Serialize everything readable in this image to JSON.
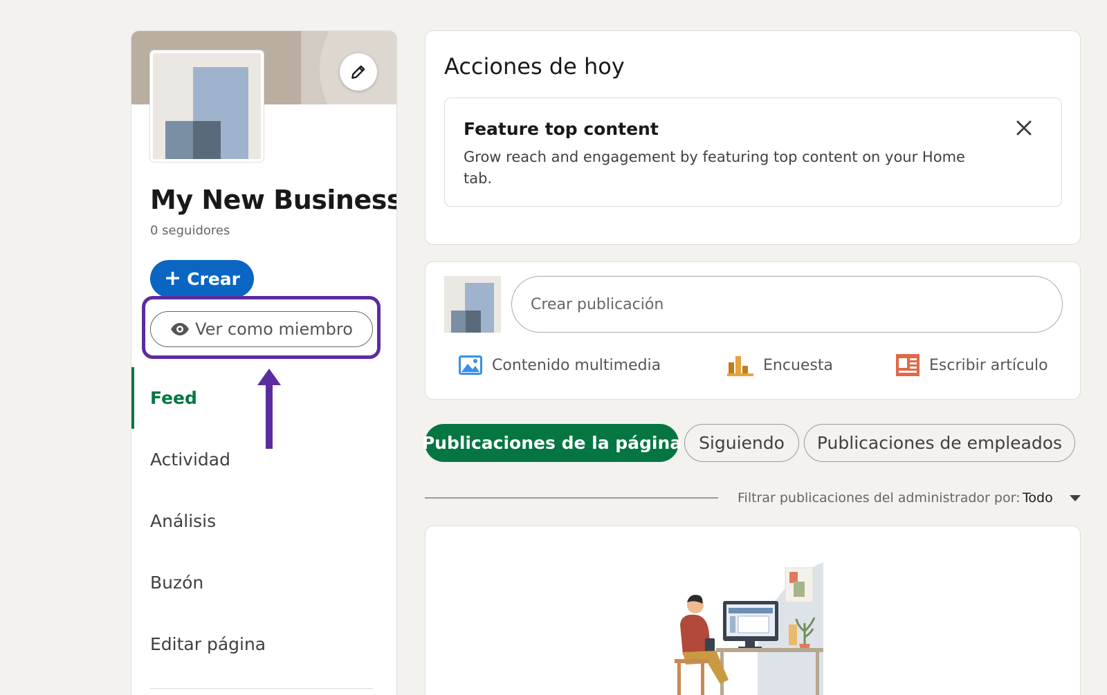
{
  "sidebar": {
    "business_name": "My New Business",
    "followers": "0 seguidores",
    "create_label": "Crear",
    "view_as_member_label": "Ver como miembro",
    "nav": [
      {
        "label": "Feed",
        "active": true
      },
      {
        "label": "Actividad",
        "active": false
      },
      {
        "label": "Análisis",
        "active": false
      },
      {
        "label": "Buzón",
        "active": false
      },
      {
        "label": "Editar página",
        "active": false
      }
    ]
  },
  "today": {
    "title": "Acciones de hoy",
    "feature": {
      "title": "Feature top content",
      "description": "Grow reach and engagement by featuring top content on your Home tab."
    }
  },
  "composer": {
    "placeholder": "Crear publicación",
    "actions": {
      "media": "Contenido multimedia",
      "poll": "Encuesta",
      "article": "Escribir artículo"
    }
  },
  "feed_tabs": {
    "page_posts": "Publicaciones de la página",
    "following": "Siguiendo",
    "employee_posts": "Publicaciones de empleados",
    "active": "page_posts"
  },
  "filter": {
    "label": "Filtrar publicaciones del administrador por:",
    "value": "Todo"
  },
  "colors": {
    "brand_blue": "#0a66c2",
    "active_green": "#057642",
    "annotation_purple": "#5b2ca0",
    "background": "#f3f2ef"
  },
  "icons": {
    "edit": "pencil-icon",
    "view": "eye-icon",
    "close": "close-icon",
    "media": "image-icon",
    "poll": "bar-chart-icon",
    "article": "article-icon",
    "filter": "caret-down-icon"
  }
}
